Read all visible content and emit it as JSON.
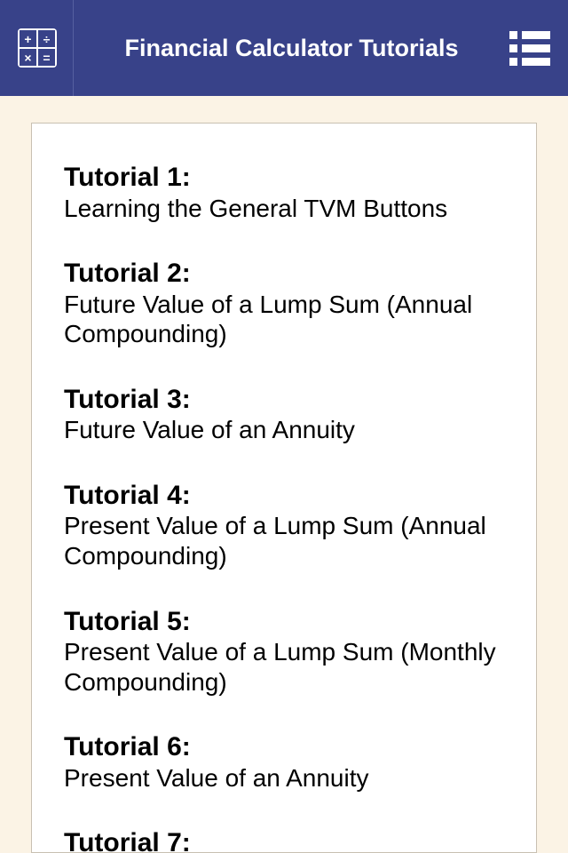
{
  "header": {
    "title": "Financial Calculator Tutorials"
  },
  "calc_icon": {
    "tl": "+",
    "tr": "÷",
    "bl": "×",
    "br": "="
  },
  "tutorials": [
    {
      "heading": "Tutorial 1:",
      "desc": "Learning the General TVM Buttons"
    },
    {
      "heading": "Tutorial 2:",
      "desc": "Future Value of a Lump Sum (Annual Compounding)"
    },
    {
      "heading": "Tutorial 3:",
      "desc": "Future Value of an Annuity"
    },
    {
      "heading": "Tutorial 4:",
      "desc": "Present Value of a Lump Sum (Annual Compounding)"
    },
    {
      "heading": "Tutorial 5:",
      "desc": "Present Value of a Lump Sum (Monthly Compounding)"
    },
    {
      "heading": "Tutorial 6:",
      "desc": "Present Value of an Annuity"
    },
    {
      "heading": "Tutorial 7:",
      "desc": ""
    }
  ]
}
